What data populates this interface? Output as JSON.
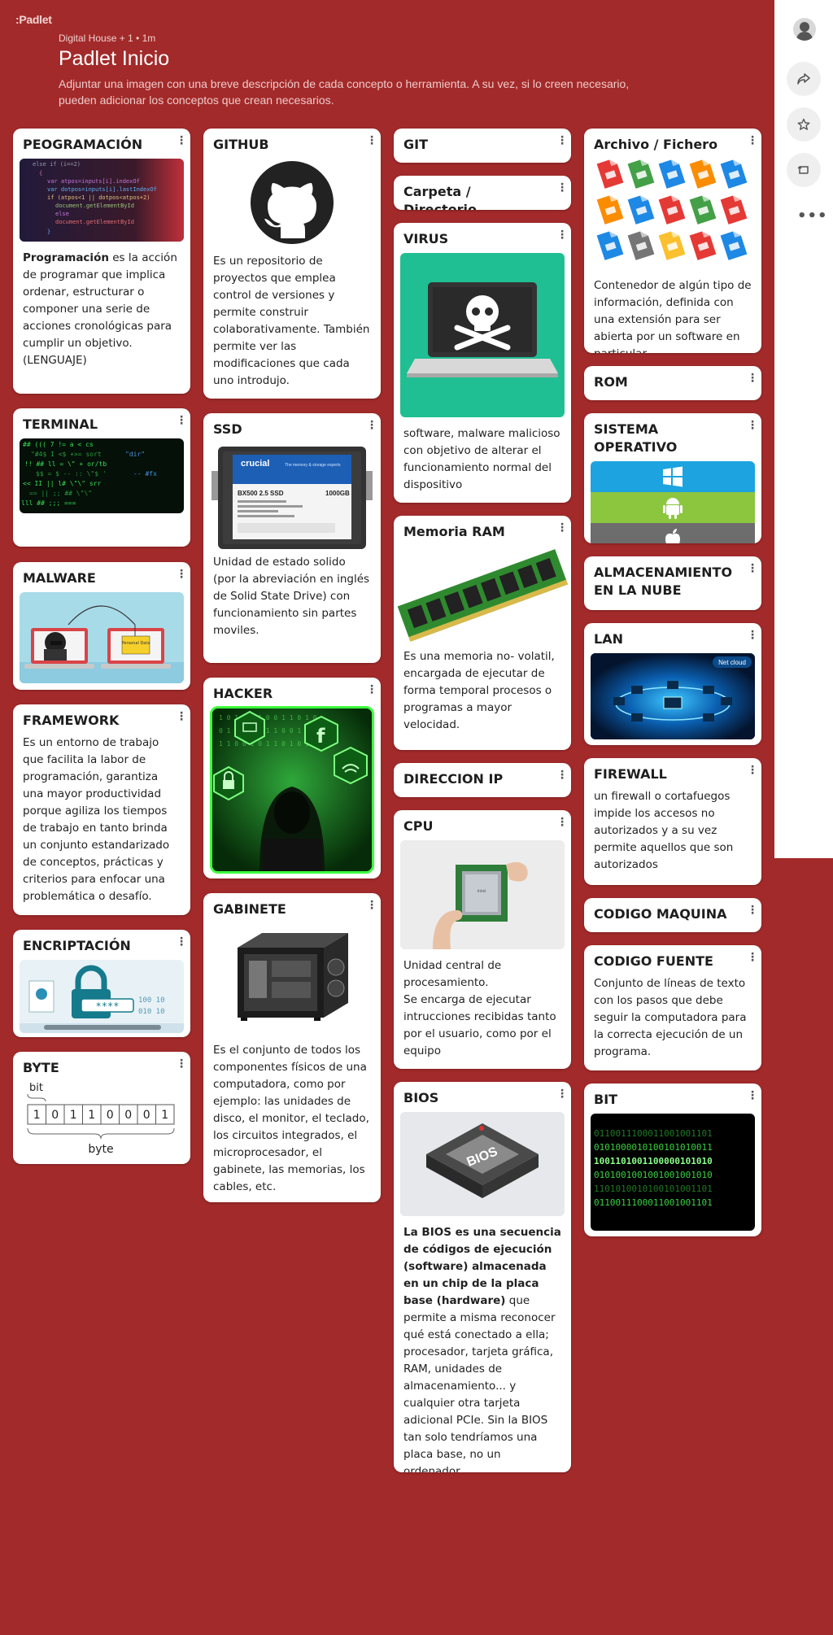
{
  "app": {
    "logo": "Padlet"
  },
  "header": {
    "meta": "Digital House + 1 • 1m",
    "title": "Padlet Inicio",
    "description": "Adjuntar una imagen con una breve descripción de cada concepto o herramienta. A su vez, si lo creen necesario, pueden adicionar los conceptos que crean necesarios."
  },
  "sidebar": {
    "icons": [
      "avatar",
      "share-icon",
      "star-icon",
      "remake-icon",
      "more-icon"
    ],
    "more_label": "•••"
  },
  "cards": {
    "programacion": {
      "title": "PEOGRAMACIÓN",
      "body_bold": "Programación",
      "body": " es la acción de programar que implica ordenar, estructurar o componer una serie de acciones cronológicas para cumplir un objetivo. (LENGUAJE)"
    },
    "terminal": {
      "title": "TERMINAL"
    },
    "malware": {
      "title": "MALWARE",
      "note": "Personal Data"
    },
    "framework": {
      "title": "FRAMEWORK",
      "body": "Es un entorno de trabajo que facilita la labor de programación, garantiza una mayor productividad porque agiliza los tiempos de trabajo en tanto brinda un conjunto estandarizado de conceptos, prácticas y criterios para enfocar una problemática o desafío."
    },
    "encriptacion": {
      "title": "ENCRIPTACIÓN",
      "stars": "****"
    },
    "byte": {
      "title": "BYTE",
      "bit_label": "bit",
      "bits": [
        "1",
        "0",
        "1",
        "1",
        "0",
        "0",
        "0",
        "1"
      ],
      "byte_label": "byte"
    },
    "github": {
      "title": "GITHUB",
      "body": "Es un repositorio de proyectos que emplea control de versiones y permite construir colaborativamente. También permite ver las modificaciones que cada uno introdujo."
    },
    "ssd": {
      "title": "SSD",
      "brand": "crucial",
      "model": "BX500 2.5 SSD",
      "capacity": "1000GB",
      "body": "Unidad de estado solido (por la abreviación en inglés de Solid State Drive) con funcionamiento sin partes moviles."
    },
    "hacker": {
      "title": "HACKER"
    },
    "gabinete": {
      "title": "GABINETE",
      "body": "Es el conjunto de todos los componentes físicos de una computadora, como por ejemplo: las unidades de disco, el monitor, el teclado, los circuitos integrados, el microprocesador, el gabinete, las memorias, los cables, etc."
    },
    "git": {
      "title": "GIT"
    },
    "carpeta": {
      "title": "Carpeta / Directorio"
    },
    "virus": {
      "title": "VIRUS",
      "body": "software, malware malicioso con objetivo de alterar el funcionamiento normal del dispositivo"
    },
    "ram": {
      "title": "Memoria RAM",
      "body": "Es una memoria no- volatil, encargada de ejecutar de forma temporal procesos o programas a mayor velocidad."
    },
    "ip": {
      "title": "DIRECCION IP"
    },
    "cpu": {
      "title": "CPU",
      "body": "Unidad central de procesamiento.\nSe encarga de ejecutar intrucciones recibidas tanto por el usuario, como por el equipo"
    },
    "bios": {
      "title": "BIOS",
      "chip_label": "BIOS",
      "body_bold": "La BIOS es una secuencia de códigos de ejecución (software) almacenada en un chip de la placa base (hardware)",
      "body": " que permite a misma reconocer qué está conectado a ella; procesador, tarjeta gráfica, RAM, unidades de almacenamiento... y cualquier otra tarjeta adicional PCIe. Sin la BIOS tan solo tendríamos una placa base, no un ordenador."
    },
    "archivo": {
      "title": "Archivo / Fichero",
      "body": "Contenedor de algún tipo de información, definida con una extensión para ser abierta por un software en particular."
    },
    "rom": {
      "title": "ROM"
    },
    "so": {
      "title": "SISTEMA OPERATIVO"
    },
    "nube": {
      "title": "ALMACENAMIENTO EN LA NUBE"
    },
    "lan": {
      "title": "LAN",
      "logo": "Net cloud"
    },
    "firewall": {
      "title": "FIREWALL",
      "body": "un firewall o cortafuegos impide los accesos no autorizados y a su vez permite aquellos que son autorizados"
    },
    "codigo_maquina": {
      "title": "CODIGO MAQUINA"
    },
    "codigo_fuente": {
      "title": "CODIGO FUENTE",
      "body": "Conjunto de líneas de texto con los pasos que debe seguir la computadora para la correcta ejecución de un programa."
    },
    "bit": {
      "title": "BIT",
      "rows": [
        "0110011100011001001101",
        "0101000010100101010011",
        "1001101001100000101010",
        "0101001001001001001010",
        "1101010010100101001101",
        "0110011100011001001101"
      ]
    }
  },
  "colors": {
    "background": "#a32a2a",
    "card": "#ffffff",
    "virus_bg": "#1fbf93",
    "windows": "#1ca3e0",
    "android": "#8cc63f",
    "apple": "#6d6d6d"
  }
}
